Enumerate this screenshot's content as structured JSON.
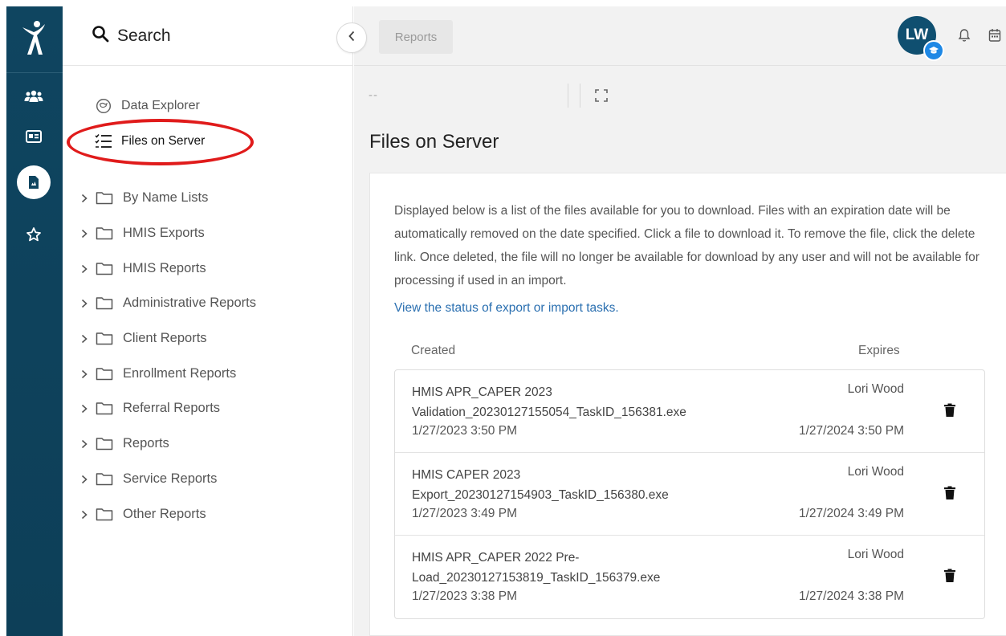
{
  "header": {
    "search_label": "Search",
    "tab_label": "Reports",
    "avatar_initials": "LW"
  },
  "colors": {
    "rail": "#0f4560",
    "accent": "#1e88e5",
    "link": "#2a6fb0",
    "highlight": "#e01b1b"
  },
  "rail": {
    "items": [
      "people-icon",
      "id-card-icon",
      "report-icon",
      "star-icon"
    ],
    "active": "report-icon"
  },
  "sidebar": {
    "nav": [
      {
        "label": "Data Explorer",
        "icon": "compass-icon"
      },
      {
        "label": "Files on Server",
        "icon": "checklist-icon",
        "current": true
      }
    ],
    "folders": [
      "By Name Lists",
      "HMIS Exports",
      "HMIS Reports",
      "Administrative Reports",
      "Client Reports",
      "Enrollment Reports",
      "Referral Reports",
      "Reports",
      "Service Reports",
      "Other Reports"
    ]
  },
  "main": {
    "breadcrumb": "--",
    "title": "Files on Server",
    "intro": "Displayed below is a list of the files available for you to download. Files with an expiration date will be automatically removed on the date specified. Click a file to download it. To remove the file, click the delete link. Once deleted, the file will no longer be available for download by any user and will not be available for processing if used in an import.",
    "status_link": "View the status of export or import tasks.",
    "columns": {
      "created": "Created",
      "expires": "Expires"
    },
    "files": [
      {
        "name": "HMIS APR_CAPER 2023 Validation_20230127155054_TaskID_156381.exe",
        "created": "1/27/2023 3:50 PM",
        "user": "Lori Wood",
        "expires": "1/27/2024 3:50 PM"
      },
      {
        "name": "HMIS CAPER 2023 Export_20230127154903_TaskID_156380.exe",
        "created": "1/27/2023 3:49 PM",
        "user": "Lori Wood",
        "expires": "1/27/2024 3:49 PM"
      },
      {
        "name": "HMIS APR_CAPER 2022 Pre-Load_20230127153819_TaskID_156379.exe",
        "created": "1/27/2023 3:38 PM",
        "user": "Lori Wood",
        "expires": "1/27/2024 3:38 PM"
      }
    ]
  }
}
